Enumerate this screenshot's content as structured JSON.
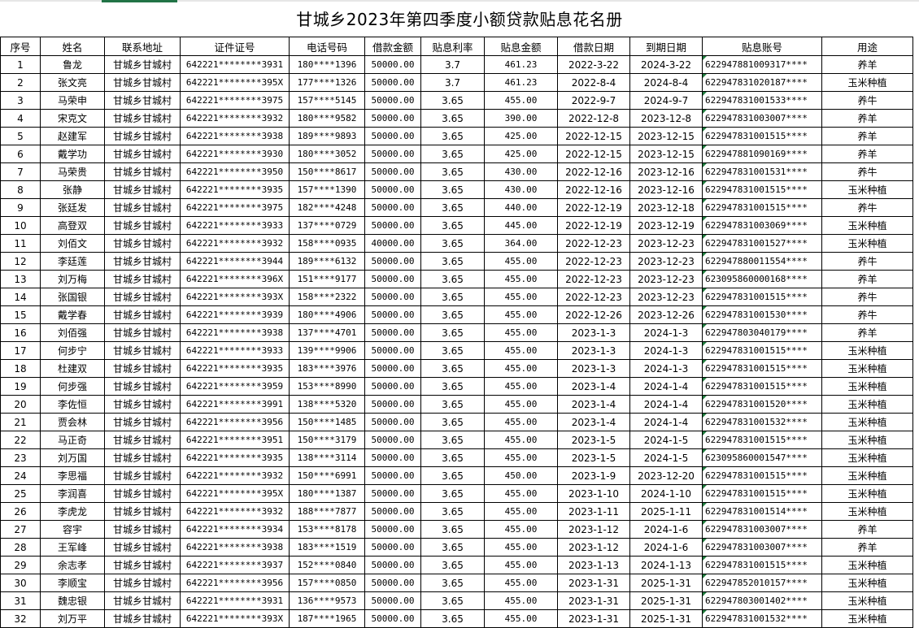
{
  "title": "甘城乡2023年第四季度小额贷款贴息花名册",
  "columns": [
    "序号",
    "姓名",
    "联系地址",
    "证件证号",
    "电话号码",
    "借款金额",
    "贴息利率",
    "贴息金额",
    "借款日期",
    "到期日期",
    "贴息账号",
    "用途"
  ],
  "rows": [
    [
      "1",
      "鲁龙",
      "甘城乡甘城村",
      "642221********3931",
      "180****1396",
      "50000.00",
      "3.7",
      "461.23",
      "2022-3-22",
      "2024-3-22",
      "622947881009317****",
      "养羊"
    ],
    [
      "2",
      "张文亮",
      "甘城乡甘城村",
      "642221********395X",
      "177****1326",
      "50000.00",
      "3.7",
      "461.23",
      "2022-8-4",
      "2024-8-4",
      "622947831020187****",
      "玉米种植"
    ],
    [
      "3",
      "马荣申",
      "甘城乡甘城村",
      "642221********3975",
      "157****5145",
      "50000.00",
      "3.65",
      "455.00",
      "2022-9-7",
      "2024-9-7",
      "622947831001533****",
      "养牛"
    ],
    [
      "4",
      "宋克文",
      "甘城乡甘城村",
      "642221********3932",
      "180****9582",
      "50000.00",
      "3.65",
      "390.00",
      "2022-12-8",
      "2023-12-8",
      "622947831003007****",
      "养羊"
    ],
    [
      "5",
      "赵建军",
      "甘城乡甘城村",
      "642221********3938",
      "189****9893",
      "50000.00",
      "3.65",
      "425.00",
      "2022-12-15",
      "2023-12-15",
      "622947831001515****",
      "养羊"
    ],
    [
      "6",
      "戴学功",
      "甘城乡甘城村",
      "642221********3930",
      "180****3052",
      "50000.00",
      "3.65",
      "425.00",
      "2022-12-15",
      "2023-12-15",
      "622947881090169****",
      "养羊"
    ],
    [
      "7",
      "马荣贵",
      "甘城乡甘城村",
      "642221********3950",
      "150****8617",
      "50000.00",
      "3.65",
      "430.00",
      "2022-12-16",
      "2023-12-16",
      "622947831001531****",
      "养牛"
    ],
    [
      "8",
      "张静",
      "甘城乡甘城村",
      "642221********3935",
      "157****1390",
      "50000.00",
      "3.65",
      "430.00",
      "2022-12-16",
      "2023-12-16",
      "622947831001515****",
      "玉米种植"
    ],
    [
      "9",
      "张廷发",
      "甘城乡甘城村",
      "642221********3975",
      "182****4248",
      "50000.00",
      "3.65",
      "440.00",
      "2022-12-19",
      "2023-12-18",
      "622947831001515****",
      "养牛"
    ],
    [
      "10",
      "高登双",
      "甘城乡甘城村",
      "642221********3933",
      "137****0729",
      "50000.00",
      "3.65",
      "445.00",
      "2022-12-19",
      "2023-12-19",
      "622947831003069****",
      "玉米种植"
    ],
    [
      "11",
      "刘佰文",
      "甘城乡甘城村",
      "642221********3932",
      "158****0935",
      "40000.00",
      "3.65",
      "364.00",
      "2022-12-23",
      "2023-12-23",
      "622947831001527****",
      "玉米种植"
    ],
    [
      "12",
      "李廷莲",
      "甘城乡甘城村",
      "642221********3944",
      "189****6132",
      "50000.00",
      "3.65",
      "455.00",
      "2022-12-23",
      "2023-12-23",
      "622947880011554****",
      "养牛"
    ],
    [
      "13",
      "刘万梅",
      "甘城乡甘城村",
      "642221********396X",
      "151****9177",
      "50000.00",
      "3.65",
      "455.00",
      "2022-12-23",
      "2023-12-23",
      "623095860000168****",
      "养羊"
    ],
    [
      "14",
      "张国银",
      "甘城乡甘城村",
      "642221********393X",
      "158****2322",
      "50000.00",
      "3.65",
      "455.00",
      "2022-12-23",
      "2023-12-23",
      "622947831001515****",
      "养牛"
    ],
    [
      "15",
      "戴学春",
      "甘城乡甘城村",
      "642221********3939",
      "180****4906",
      "50000.00",
      "3.65",
      "455.00",
      "2022-12-26",
      "2023-12-26",
      "622947831001530****",
      "养牛"
    ],
    [
      "16",
      "刘佰强",
      "甘城乡甘城村",
      "642221********3938",
      "137****4701",
      "50000.00",
      "3.65",
      "455.00",
      "2023-1-3",
      "2024-1-3",
      "622947803040179****",
      "养羊"
    ],
    [
      "17",
      "何步宁",
      "甘城乡甘城村",
      "642221********3933",
      "139****9906",
      "50000.00",
      "3.65",
      "455.00",
      "2023-1-3",
      "2024-1-3",
      "622947831001515****",
      "玉米种植"
    ],
    [
      "18",
      "杜建双",
      "甘城乡甘城村",
      "642221********3935",
      "183****3976",
      "50000.00",
      "3.65",
      "455.00",
      "2023-1-3",
      "2024-1-3",
      "622947831001515****",
      "玉米种植"
    ],
    [
      "19",
      "何步强",
      "甘城乡甘城村",
      "642221********3959",
      "153****8990",
      "50000.00",
      "3.65",
      "455.00",
      "2023-1-4",
      "2024-1-4",
      "622947831001515****",
      "玉米种植"
    ],
    [
      "20",
      "李佐恒",
      "甘城乡甘城村",
      "642221********3991",
      "138****5320",
      "50000.00",
      "3.65",
      "455.00",
      "2023-1-4",
      "2024-1-4",
      "622947831001520****",
      "玉米种植"
    ],
    [
      "21",
      "贾会林",
      "甘城乡甘城村",
      "642221********3956",
      "150****1485",
      "50000.00",
      "3.65",
      "455.00",
      "2023-1-4",
      "2024-1-4",
      "622947831001532****",
      "玉米种植"
    ],
    [
      "22",
      "马正奇",
      "甘城乡甘城村",
      "642221********3951",
      "150****3179",
      "50000.00",
      "3.65",
      "455.00",
      "2023-1-5",
      "2024-1-5",
      "622947831001515****",
      "玉米种植"
    ],
    [
      "23",
      "刘万国",
      "甘城乡甘城村",
      "642221********3935",
      "138****3114",
      "50000.00",
      "3.65",
      "455.00",
      "2023-1-5",
      "2024-1-5",
      "623095860001547****",
      "玉米种植"
    ],
    [
      "24",
      "李思福",
      "甘城乡甘城村",
      "642221********3932",
      "150****6991",
      "50000.00",
      "3.65",
      "450.00",
      "2023-1-9",
      "2023-12-20",
      "622947831001515****",
      "玉米种植"
    ],
    [
      "25",
      "李润喜",
      "甘城乡甘城村",
      "642221********395X",
      "180****1387",
      "50000.00",
      "3.65",
      "455.00",
      "2023-1-10",
      "2024-1-10",
      "622947831001515****",
      "玉米种植"
    ],
    [
      "26",
      "李虎龙",
      "甘城乡甘城村",
      "642221********3932",
      "188****7877",
      "50000.00",
      "3.65",
      "455.00",
      "2023-1-11",
      "2025-1-11",
      "622947831001514****",
      "玉米种植"
    ],
    [
      "27",
      "容宇",
      "甘城乡甘城村",
      "642221********3934",
      "153****8178",
      "50000.00",
      "3.65",
      "455.00",
      "2023-1-12",
      "2024-1-6",
      "622947831003007****",
      "养羊"
    ],
    [
      "28",
      "王军峰",
      "甘城乡甘城村",
      "642221********3938",
      "183****1519",
      "50000.00",
      "3.65",
      "455.00",
      "2023-1-12",
      "2024-1-6",
      "622947831003007****",
      "养羊"
    ],
    [
      "29",
      "余志孝",
      "甘城乡甘城村",
      "642221********3937",
      "152****0840",
      "50000.00",
      "3.65",
      "455.00",
      "2023-1-13",
      "2024-1-13",
      "622947831001515****",
      "玉米种植"
    ],
    [
      "30",
      "李顺宝",
      "甘城乡甘城村",
      "642221********3956",
      "157****0850",
      "50000.00",
      "3.65",
      "455.00",
      "2023-1-31",
      "2025-1-31",
      "622947852010157****",
      "玉米种植"
    ],
    [
      "31",
      "魏忠银",
      "甘城乡甘城村",
      "642221********3931",
      "136****9573",
      "50000.00",
      "3.65",
      "455.00",
      "2023-1-31",
      "2025-1-31",
      "622947803001402****",
      "玉米种植"
    ],
    [
      "32",
      "刘万平",
      "甘城乡甘城村",
      "642221********393X",
      "187****1965",
      "50000.00",
      "3.65",
      "455.00",
      "2023-1-31",
      "2025-1-31",
      "622947831001532****",
      "玉米种植"
    ]
  ]
}
